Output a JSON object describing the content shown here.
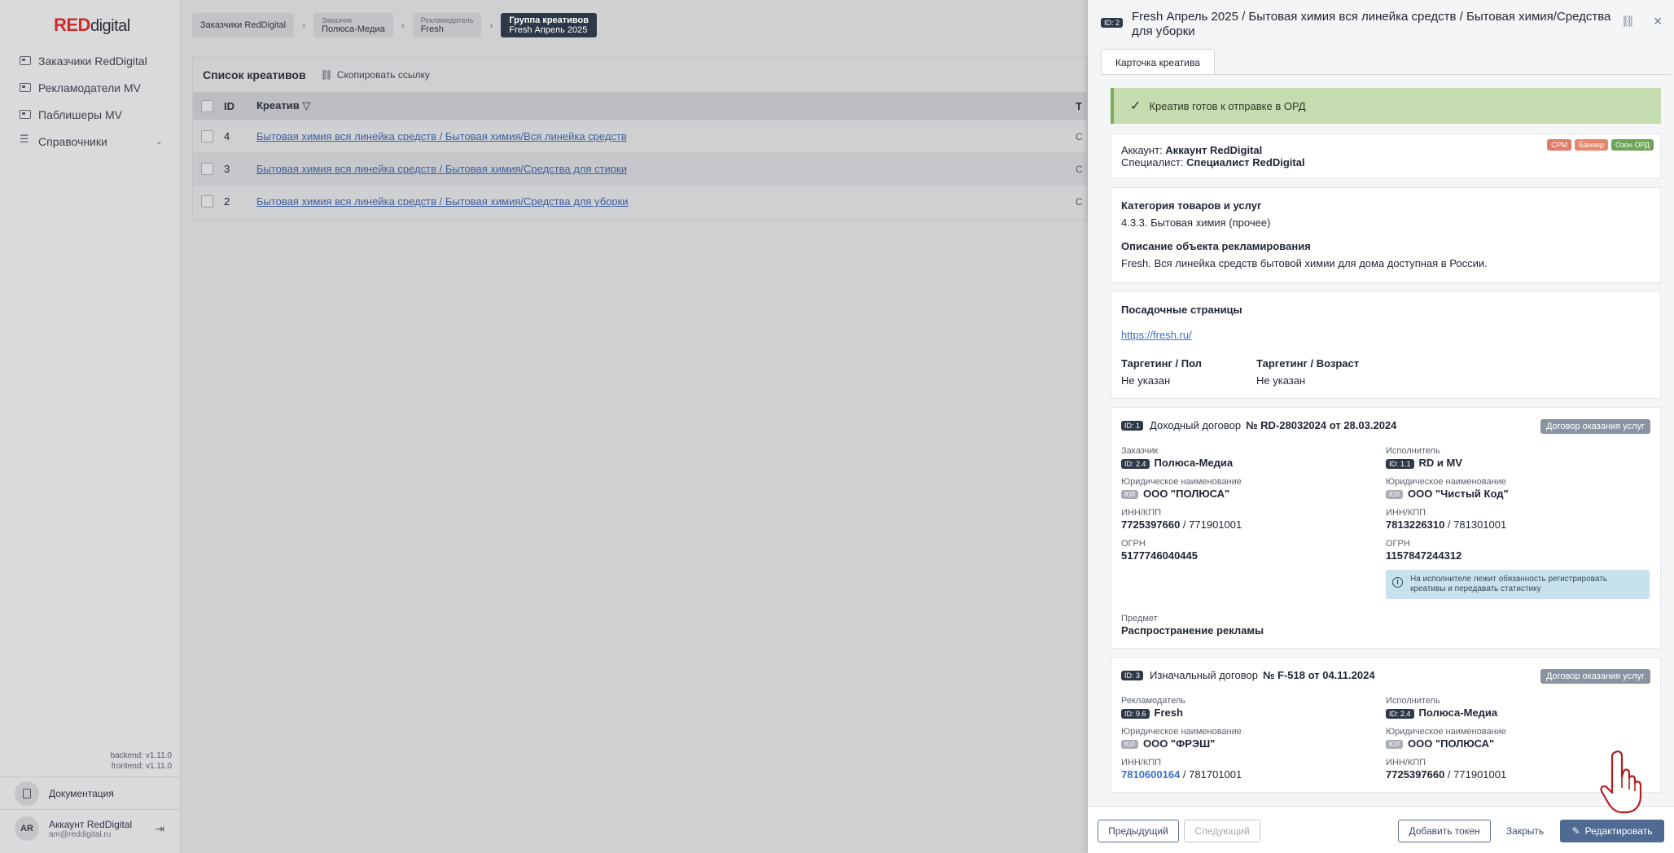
{
  "logo": {
    "red": "RED",
    "digital": "digital"
  },
  "nav": [
    {
      "label": "Заказчики RedDigital"
    },
    {
      "label": "Рекламодатели MV"
    },
    {
      "label": "Паблишеры MV"
    },
    {
      "label": "Справочники"
    }
  ],
  "versions": {
    "backend": "backend: v1.11.0",
    "frontend": "frontend: v1.11.0"
  },
  "docs_label": "Документация",
  "account": {
    "initials": "AR",
    "name": "Аккаунт RedDigital",
    "email": "am@reddigital.ru"
  },
  "breadcrumbs": [
    {
      "top": "Заказчики RedDigital",
      "sub": ""
    },
    {
      "sub": "Заказчик",
      "top": "Полюса-Медиа"
    },
    {
      "sub": "Рекламодатель",
      "top": "Fresh"
    },
    {
      "top": "Группа креативов",
      "sub": "Fresh Апрель 2025"
    }
  ],
  "list": {
    "title": "Список креативов",
    "copy_link": "Скопировать ссылку",
    "columns": {
      "id": "ID",
      "creative": "Креатив",
      "t": "Т"
    },
    "rows": [
      {
        "id": "4",
        "name": "Бытовая химия вся линейка средств / Бытовая химия/Вся линейка средств",
        "t": "С"
      },
      {
        "id": "3",
        "name": "Бытовая химия вся линейка средств / Бытовая химия/Средства для стирки",
        "t": "С"
      },
      {
        "id": "2",
        "name": "Бытовая химия вся линейка средств / Бытовая химия/Средства для уборки",
        "t": "С"
      }
    ]
  },
  "drawer": {
    "id_badge": "ID: 2",
    "title": "Fresh Апрель 2025 / Бытовая химия вся линейка средств / Бытовая химия/Средства для уборки",
    "tab": "Карточка креатива",
    "ready_text": "Креатив готов к отправке в ОРД",
    "account_label": "Аккаунт:",
    "account_value": "Аккаунт RedDigital",
    "specialist_label": "Специалист:",
    "specialist_value": "Специалист RedDigital",
    "tags": [
      "CPM",
      "Баннер",
      "Озон ОРД"
    ],
    "category_h": "Категория товаров и услуг",
    "category_v": "4.3.3. Бытовая химия (прочее)",
    "desc_h": "Описание объекта рекламирования",
    "desc_v": "Fresh. Вся линейка средств бытовой химии для дома доступная в России.",
    "landing_h": "Посадочные страницы",
    "landing_url": "https://fresh.ru/",
    "tg_gender_h": "Таргетинг / Пол",
    "tg_gender_v": "Не указан",
    "tg_age_h": "Таргетинг / Возраст",
    "tg_age_v": "Не указан",
    "contract1": {
      "id": "ID: 1",
      "kind": "Доходный договор",
      "num": "№ RD-28032024 от 28.03.2024",
      "type": "Договор оказания услуг",
      "left_role": "Заказчик",
      "left_id": "ID: 2.4",
      "left_name": "Полюса-Медиа",
      "right_role": "Исполнитель",
      "right_id": "ID: 1.1",
      "right_name": "RD и MV",
      "legal_label": "Юридическое наименование",
      "ul": "ЮЛ",
      "left_legal": "ООО \"ПОЛЮСА\"",
      "right_legal": "ООО \"Чистый Код\"",
      "inn_label": "ИНН/КПП",
      "left_inn": "7725397660",
      "left_kpp": " / 771901001",
      "right_inn": "7813226310",
      "right_kpp": " / 781301001",
      "ogrn_label": "ОГРН",
      "left_ogrn": "5177746040445",
      "right_ogrn": "1157847244312",
      "info": "На исполнителе лежит обязанность регистрировать креативы и передавать статистику",
      "subject_label": "Предмет",
      "subject": "Распространение рекламы"
    },
    "contract2": {
      "id": "ID: 3",
      "kind": "Изначальный договор",
      "num": "№ F-518 от 04.11.2024",
      "type": "Договор оказания услуг",
      "left_role": "Рекламодатель",
      "left_id": "ID: 9.6",
      "left_name": "Fresh",
      "right_role": "Исполнитель",
      "right_id": "ID: 2.4",
      "right_name": "Полюса-Медиа",
      "legal_label": "Юридическое наименование",
      "ul": "ЮЛ",
      "left_legal": "ООО \"ФРЭШ\"",
      "right_legal": "ООО \"ПОЛЮСА\"",
      "inn_label": "ИНН/КПП",
      "left_inn": "7810600164",
      "left_kpp": " / 781701001",
      "right_inn": "7725397660",
      "right_kpp": " / 771901001"
    },
    "footer": {
      "prev": "Предыдущий",
      "next": "Следующий",
      "add_token": "Добавить токен",
      "close": "Закрыть",
      "edit": "Редактировать"
    }
  }
}
